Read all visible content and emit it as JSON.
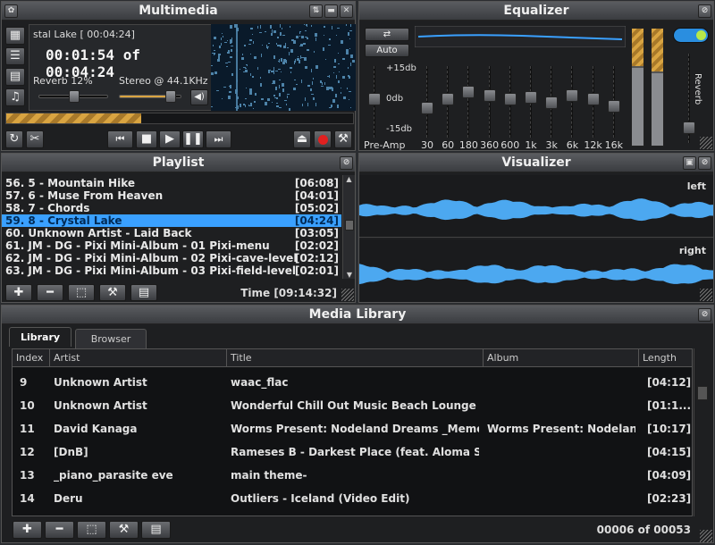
{
  "multimedia": {
    "title": "Multimedia",
    "track_name": "stal Lake [ 00:04:24]",
    "time": "00:01:54 of 00:04:24",
    "reverb": "Reverb 12%",
    "stereo": "Stereo @ 44.1KHz",
    "progress": 0.39
  },
  "equalizer": {
    "title": "Equalizer",
    "auto_label": "Auto",
    "db_top": "+15db",
    "db_mid": "0db",
    "db_bot": "-15db",
    "preamp_label": "Pre-Amp",
    "reverb_label": "Reverb",
    "bands": [
      "30",
      "60",
      "180",
      "360",
      "600",
      "1k",
      "3k",
      "6k",
      "12k",
      "16k"
    ]
  },
  "playlist": {
    "title": "Playlist",
    "rows": [
      {
        "name": "56. 5 - Mountain Hike",
        "dur": "[06:08]"
      },
      {
        "name": "57. 6 - Muse From Heaven",
        "dur": "[04:01]"
      },
      {
        "name": "58. 7 - Chords",
        "dur": "[05:02]"
      },
      {
        "name": "59. 8 - Crystal Lake",
        "dur": "[04:24]"
      },
      {
        "name": "60. Unknown Artist - Laid Back",
        "dur": "[03:05]"
      },
      {
        "name": "61. JM - DG - Pixi Mini-Album - 01 Pixi-menu",
        "dur": "[02:02]"
      },
      {
        "name": "62. JM - DG - Pixi Mini-Album - 02 Pixi-cave-level",
        "dur": "[02:12]"
      },
      {
        "name": "63. JM - DG - Pixi Mini-Album - 03 Pixi-field-level",
        "dur": "[02:01]"
      }
    ],
    "total_time": "Time [09:14:32]"
  },
  "visualizer": {
    "title": "Visualizer",
    "left_label": "left",
    "right_label": "right"
  },
  "library": {
    "title": "Media Library",
    "tabs": [
      "Library",
      "Browser"
    ],
    "columns": [
      "Index",
      "Artist",
      "Title",
      "Album",
      "Length"
    ],
    "rows": [
      {
        "index": "9",
        "artist": "Unknown Artist",
        "title": "waac_flac",
        "album": "",
        "length": "[04:12]"
      },
      {
        "index": "10",
        "artist": "Unknown Artist",
        "title": "Wonderful Chill Out Music Beach Lounge M...",
        "album": "",
        "length": "[01:1..."
      },
      {
        "index": "11",
        "artist": "David Kanaga",
        "title": "Worms Present: Nodeland Dreams _Memo...",
        "album": "Worms Present: Nodelan...",
        "length": "[10:17]"
      },
      {
        "index": "12",
        "artist": "[DnB]",
        "title": "Rameses B - Darkest Place (feat. Aloma Ste...",
        "album": "",
        "length": "[04:15]"
      },
      {
        "index": "13",
        "artist": "_piano_parasite eve",
        "title": "main theme-",
        "album": "",
        "length": "[04:09]"
      },
      {
        "index": "14",
        "artist": "Deru",
        "title": "Outliers - Iceland (Video Edit)",
        "album": "",
        "length": "[02:23]"
      }
    ],
    "count": "00006 of 00053"
  },
  "colors": {
    "accent": "#3aa0ff",
    "progress": "#d9a441"
  }
}
